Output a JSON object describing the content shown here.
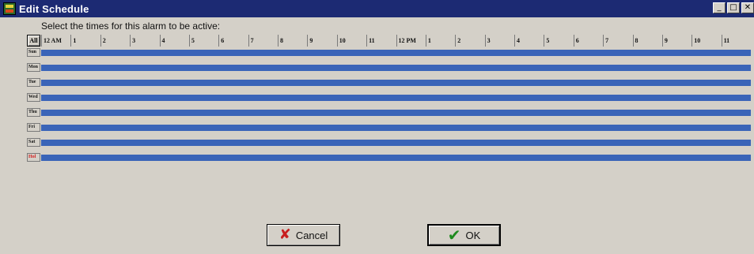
{
  "window": {
    "title": "Edit Schedule",
    "controls": {
      "minimize": "_",
      "maximize": "□",
      "close": "✕"
    }
  },
  "instruction": "Select the times for this alarm to be active:",
  "grid": {
    "all_label": "All",
    "hours": [
      "12 AM",
      "1",
      "2",
      "3",
      "4",
      "5",
      "6",
      "7",
      "8",
      "9",
      "10",
      "11",
      "12 PM",
      "1",
      "2",
      "3",
      "4",
      "5",
      "6",
      "7",
      "8",
      "9",
      "10",
      "11"
    ],
    "days": [
      {
        "label": "Sun",
        "active": true
      },
      {
        "label": "Mon",
        "active": true
      },
      {
        "label": "Tue",
        "active": true
      },
      {
        "label": "Wed",
        "active": true
      },
      {
        "label": "Thu",
        "active": true
      },
      {
        "label": "Fri",
        "active": true
      },
      {
        "label": "Sat",
        "active": true
      },
      {
        "label": "Hol",
        "active": true,
        "holiday": true
      }
    ],
    "active_color": "#3a64b8"
  },
  "buttons": {
    "cancel": "Cancel",
    "ok": "OK"
  },
  "icons": {
    "cancel": "x-icon",
    "ok": "check-icon"
  }
}
